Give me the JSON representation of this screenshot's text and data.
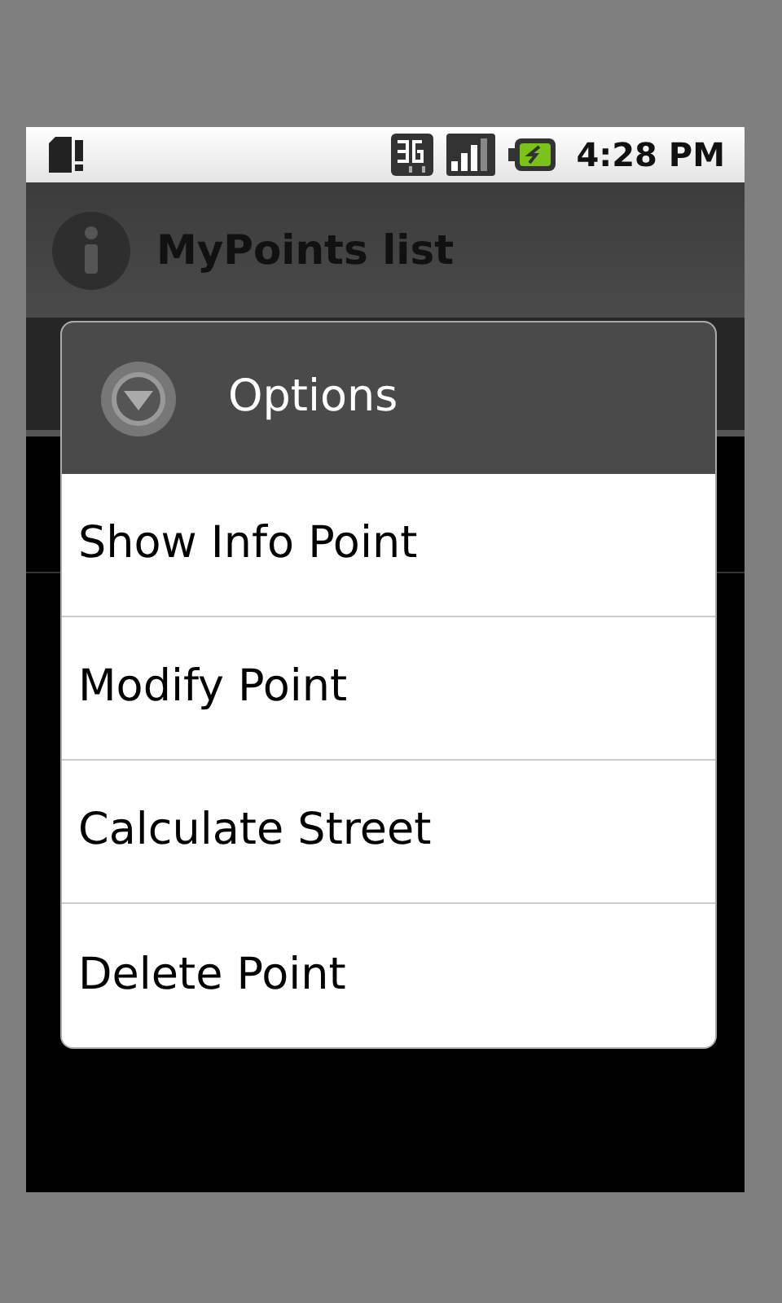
{
  "status_bar": {
    "time": "4:28 PM"
  },
  "title_bar": {
    "title": "MyPoints list"
  },
  "dialog": {
    "title": "Options",
    "items": [
      {
        "label": "Show Info Point"
      },
      {
        "label": "Modify Point"
      },
      {
        "label": "Calculate Street"
      },
      {
        "label": "Delete Point"
      }
    ]
  }
}
